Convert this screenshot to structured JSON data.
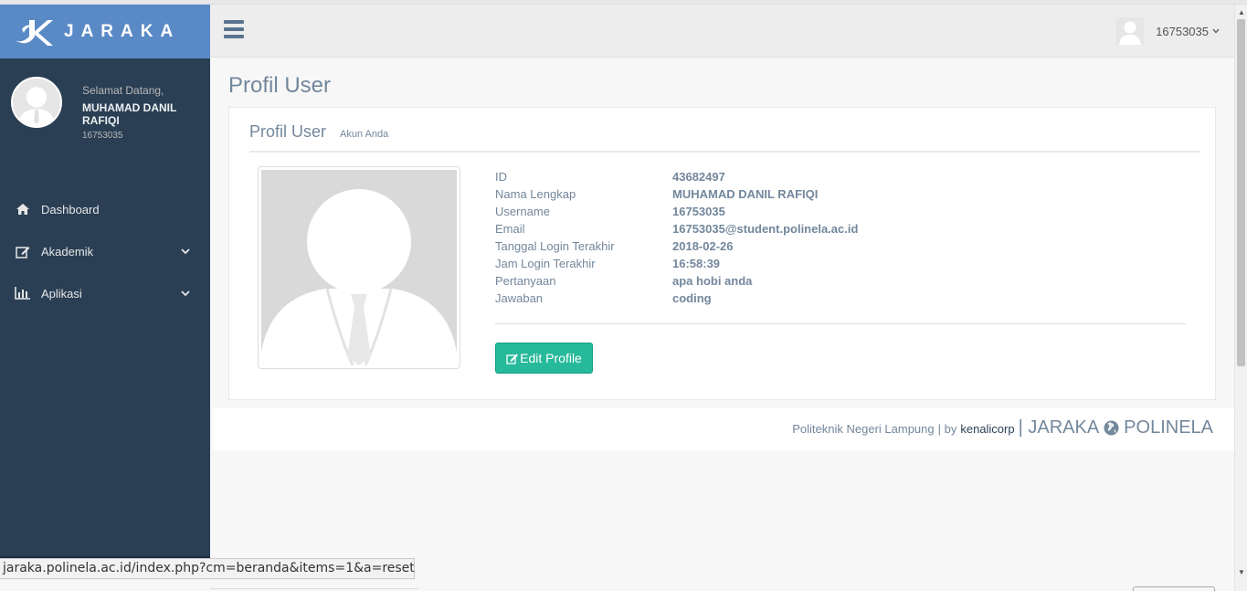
{
  "brand": {
    "name": "JARAKA",
    "logo_icon": "jk-logo-icon"
  },
  "sidebar_profile": {
    "welcome": "Selamat Datang,",
    "name": "MUHAMAD DANIL RAFIQI",
    "id": "16753035"
  },
  "menu": [
    {
      "label": "Dashboard",
      "icon": "home-icon",
      "has_submenu": false
    },
    {
      "label": "Akademik",
      "icon": "edit-icon",
      "has_submenu": true
    },
    {
      "label": "Aplikasi",
      "icon": "bar-chart-icon",
      "has_submenu": true
    }
  ],
  "topbar": {
    "user": "16753035"
  },
  "page": {
    "title": "Profil User"
  },
  "panel": {
    "title": "Profil User",
    "subtitle": "Akun Anda",
    "fields": [
      {
        "label": "ID",
        "value": "43682497"
      },
      {
        "label": "Nama Lengkap",
        "value": "MUHAMAD DANIL RAFIQI"
      },
      {
        "label": "Username",
        "value": "16753035"
      },
      {
        "label": "Email",
        "value": "16753035@student.polinela.ac.id"
      },
      {
        "label": "Tanggal Login Terakhir",
        "value": "2018-02-26"
      },
      {
        "label": "Jam Login Terakhir",
        "value": "16:58:39"
      },
      {
        "label": "Pertanyaan",
        "value": "apa hobi anda"
      },
      {
        "label": "Jawaban",
        "value": "coding"
      }
    ],
    "edit_button": "Edit Profile"
  },
  "footer": {
    "org": "Politeknik Negeri Lampung",
    "by": "| by",
    "link": "kenalicorp",
    "brand_left": "| JARAKA",
    "brand_right": "POLINELA"
  },
  "statusbar": {
    "url": "jaraka.polinela.ac.id/index.php?cm=beranda&items=1&a=reset"
  },
  "colors": {
    "sidebar": "#2A3F54",
    "brand_bar": "#5A8AC6",
    "accent_green": "#26B99A",
    "text": "#73879C"
  }
}
